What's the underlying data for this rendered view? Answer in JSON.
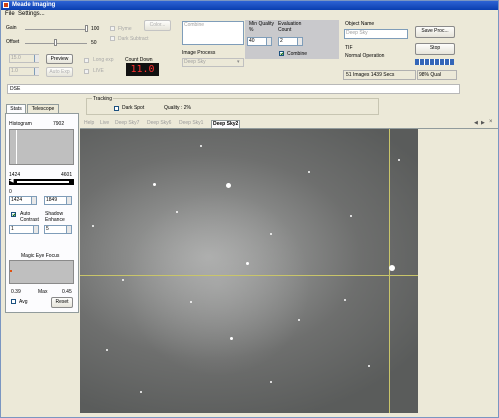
{
  "window": {
    "title": "Meade Imaging"
  },
  "menu": {
    "file": "File",
    "settings": "Settings..."
  },
  "gain": {
    "label": "Gain",
    "value": "100"
  },
  "offset": {
    "label": "Offset",
    "value": "50"
  },
  "options": {
    "flyme": "Flyme",
    "dark_subtract": "Dark Subtract",
    "color_button": "Color..."
  },
  "exposure": {
    "value1": "15.0",
    "value2": "1.0",
    "preview_button": "Preview",
    "auto_exp_button": "Auto Exp",
    "long_exp": "Long exp",
    "live": "LIVE"
  },
  "countdown": {
    "label": "Count Down",
    "value": "11.0"
  },
  "combine_panel": {
    "label": "Combine",
    "image_process_label": "Image Process",
    "image_process_value": "Deep Sky"
  },
  "quality": {
    "min_label": "Min Quality %",
    "min_value": "40",
    "eval_label": "Evaluation Count",
    "eval_value": "2",
    "combine_checkbox": "Combine"
  },
  "object": {
    "label": "Object Name",
    "name_value": "Deep Sky",
    "save_button": "Save Proc...",
    "stop_button": "Stop",
    "file_type": "TIF",
    "status": "Normal Operation",
    "images_status": "51 Images 1439 Secs",
    "quality_status": "98% Qual"
  },
  "dse": {
    "label": "DSE"
  },
  "side_tabs": [
    "Stats",
    "Telescope"
  ],
  "tracking": {
    "label": "Tracking",
    "dark_spot": "Dark Spot",
    "quality": "Quality : 2%"
  },
  "histogram": {
    "label": "Histogram",
    "max_value": "7902",
    "range_low": "1424",
    "range_high": "4601",
    "zero_label": "0",
    "min_input": "1424",
    "max_input": "1849"
  },
  "contrast": {
    "auto_label": "Auto Contrast",
    "shadow_label": "Shadow Enhance",
    "auto_value": "1",
    "shadow_value": "5"
  },
  "magic_eye": {
    "label": "Magic Eye Focus",
    "min_value": "0.39",
    "max_label": "Max",
    "max_value": "0.45",
    "avg_label": "Avg",
    "reset_button": "Reset"
  },
  "image_tabs": [
    "Help",
    "Live",
    "Deep Sky7",
    "Deep Sky6",
    "Deep Sky1",
    "Deep Sky2"
  ],
  "image_tabs_active": 5
}
